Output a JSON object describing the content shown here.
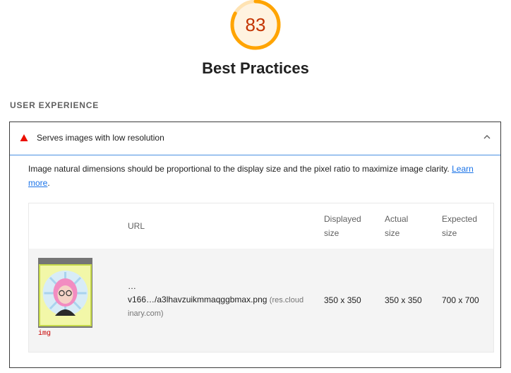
{
  "score": {
    "value": "83",
    "fraction": 0.83,
    "color": "#ffa400",
    "text_color": "#c33300"
  },
  "category": {
    "title": "Best Practices"
  },
  "group": {
    "title": "USER EXPERIENCE"
  },
  "audit": {
    "title": "Serves images with low resolution",
    "status": "warning",
    "description": "Image natural dimensions should be proportional to the display size and the pixel ratio to maximize image clarity.",
    "link_text_1": "Learn",
    "link_text_2": "more",
    "period": "."
  },
  "table": {
    "headers": {
      "url": "URL",
      "displayed_1": "Displayed",
      "displayed_2": "size",
      "actual_1": "Actual",
      "actual_2": "size",
      "expected_1": "Expected",
      "expected_2": "size"
    },
    "rows": [
      {
        "element_label": "img",
        "url_ellipsis": "…",
        "url_path": "v166…/a3lhavzuikmmaqggbmax.png",
        "url_host_1": "(res.cloud",
        "url_host_2": "inary.com)",
        "displayed": "350 x 350",
        "actual": "350 x 350",
        "expected": "700 x 700"
      }
    ]
  },
  "colors": {
    "accent_blue": "#4a90e2",
    "warning_red": "#eb0f00",
    "link": "#1a73e8"
  }
}
